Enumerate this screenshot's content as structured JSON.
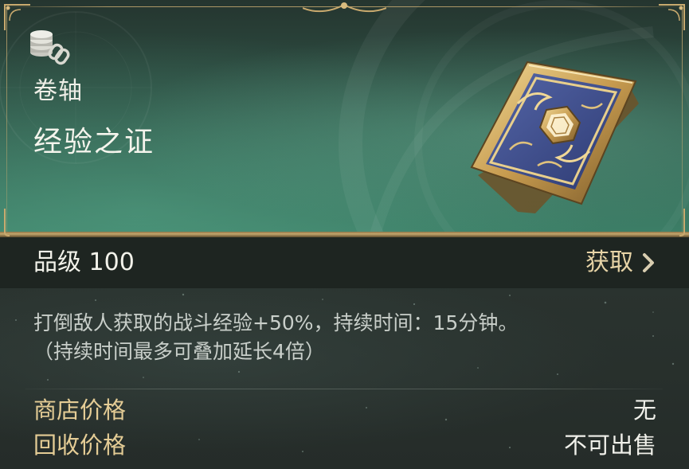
{
  "item": {
    "category": "卷轴",
    "name": "经验之证",
    "category_icon": "coin-stack-link-icon",
    "image_icon": "ornate-scroll-card-icon"
  },
  "grade": {
    "label": "品级 100",
    "acquire_label": "获取"
  },
  "description": {
    "line1": "打倒敌人获取的战斗经验+50%，持续时间：15分钟。",
    "line2": "（持续时间最多可叠加延长4倍）"
  },
  "prices": [
    {
      "label": "商店价格",
      "value": "无"
    },
    {
      "label": "回收价格",
      "value": "不可出售"
    }
  ],
  "colors": {
    "header_green": "#3d8068",
    "gold_accent": "#e4cc95",
    "acquire_gold": "#e6d3a6",
    "card_blue": "#3e4f8c",
    "frame_gold": "#c5a66c"
  }
}
